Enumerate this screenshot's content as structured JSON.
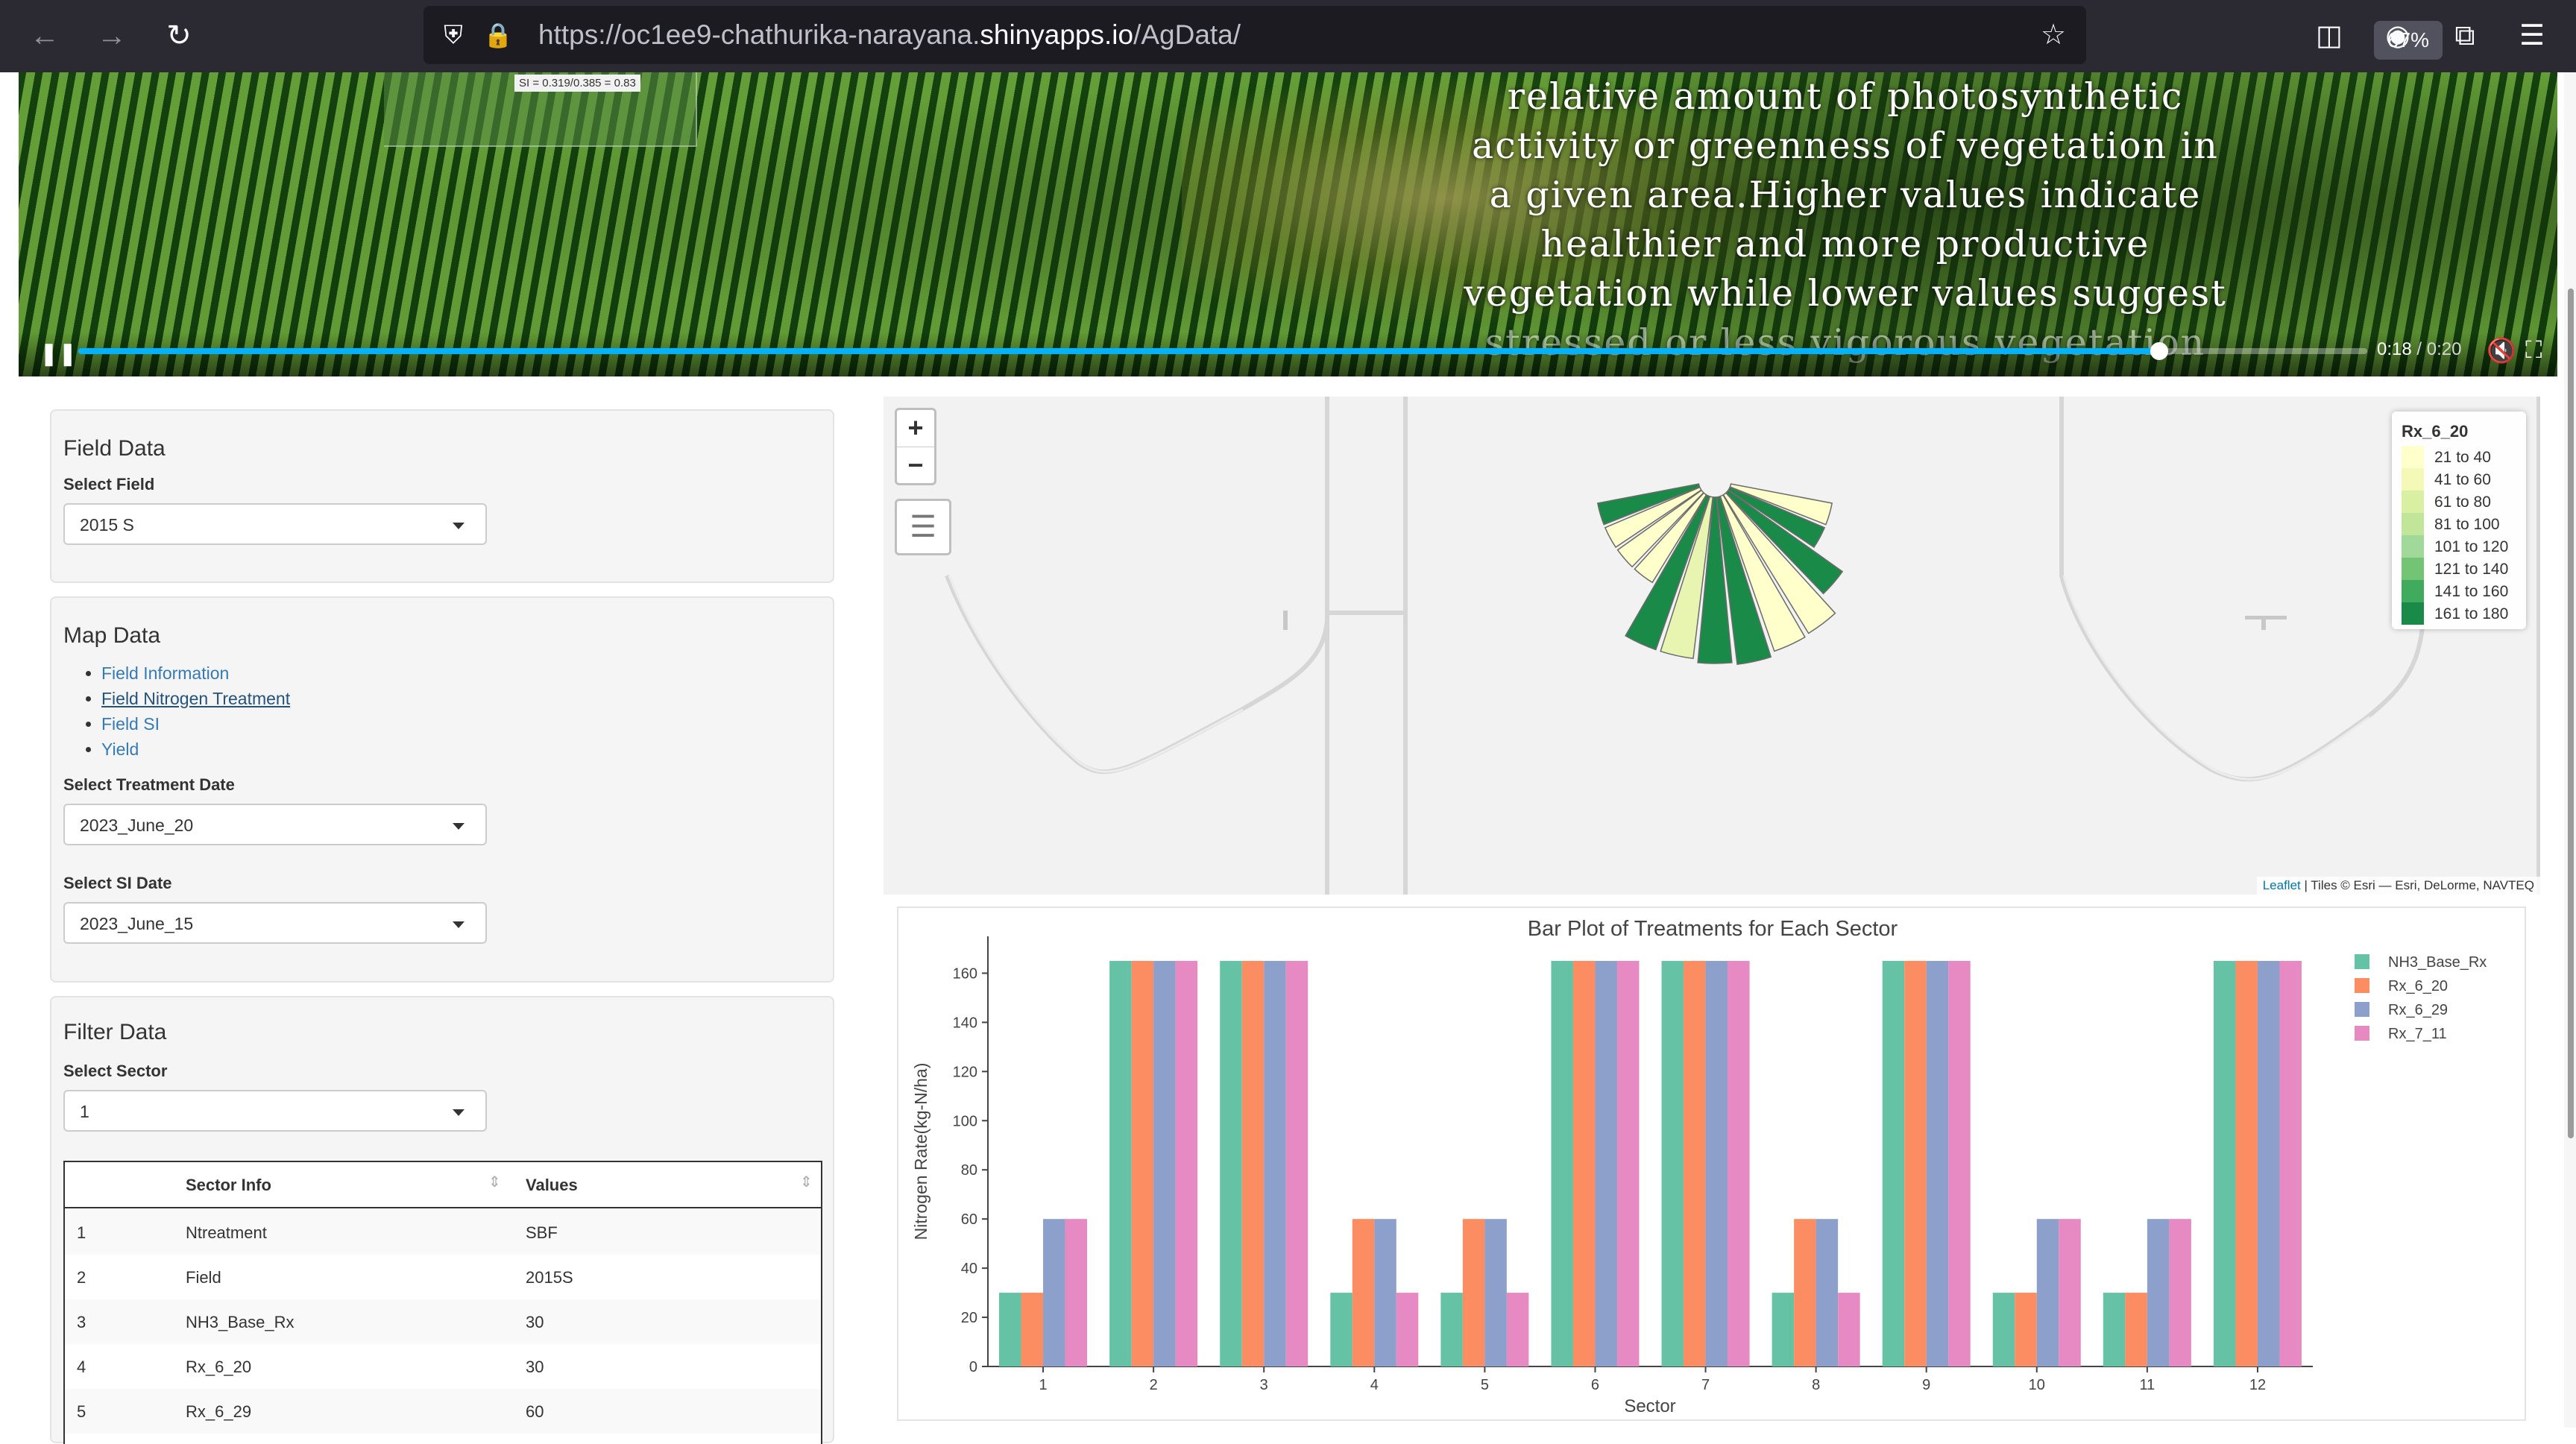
{
  "browser": {
    "url_prefix": "https://oc1ee9-chathurika-narayana.",
    "url_domain": "shinyapps.io",
    "url_path": "/AgData/",
    "zoom": "67%"
  },
  "video": {
    "inset_label": "SI = 0.319/0.385 = 0.83",
    "caption_lines": [
      "relative amount of photosynthetic",
      "activity or greenness of vegetation in",
      "a given area.Higher values indicate",
      "healthier and more productive",
      "vegetation while lower values suggest",
      "stressed or less vigorous vegetation"
    ],
    "current_time": "0:18",
    "separator": " / ",
    "duration": "0:20",
    "progress_fraction": 0.909
  },
  "field_data": {
    "title": "Field Data",
    "select_label": "Select Field",
    "selected": "2015 S"
  },
  "map_data": {
    "title": "Map Data",
    "links": [
      "Field Information",
      "Field Nitrogen Treatment",
      "Field SI",
      "Yield"
    ],
    "treatment_label": "Select Treatment Date",
    "treatment_selected": "2023_June_20",
    "si_label": "Select SI Date",
    "si_selected": "2023_June_15"
  },
  "filter_data": {
    "title": "Filter Data",
    "sector_label": "Select Sector",
    "sector_selected": "1",
    "table": {
      "headers": [
        "Sector Info",
        "Values"
      ],
      "rows": [
        [
          "1",
          "Ntreatment",
          "SBF"
        ],
        [
          "2",
          "Field",
          "2015S"
        ],
        [
          "3",
          "NH3_Base_Rx",
          "30"
        ],
        [
          "4",
          "Rx_6_20",
          "30"
        ],
        [
          "5",
          "Rx_6_29",
          "60"
        ]
      ]
    }
  },
  "map": {
    "zoom_in": "+",
    "zoom_out": "−",
    "layers_icon": "layers-icon",
    "legend_title": "Rx_6_20",
    "legend": [
      {
        "label": "21 to 40",
        "color": "#ffffcc"
      },
      {
        "label": "41 to 60",
        "color": "#f4f9b7"
      },
      {
        "label": "61 to 80",
        "color": "#d9f0a3"
      },
      {
        "label": "81 to 100",
        "color": "#c2e699"
      },
      {
        "label": "101 to 120",
        "color": "#a1d99b"
      },
      {
        "label": "121 to 140",
        "color": "#74c476"
      },
      {
        "label": "141 to 160",
        "color": "#41ab5d"
      },
      {
        "label": "161 to 180",
        "color": "#1a8a49"
      }
    ],
    "sector_colors": [
      "#1a8a49",
      "#ffffcc",
      "#ffffcc",
      "#ffffcc",
      "#1a8a49",
      "#e8f5b0",
      "#1a8a49",
      "#1a8a49",
      "#ffffcc",
      "#ffffcc",
      "#1a8a49",
      "#1a8a49",
      "#ffffcc"
    ],
    "attribution_link": "Leaflet",
    "attribution_text": " | Tiles © Esri — Esri, DeLorme, NAVTEQ"
  },
  "chart_data": {
    "type": "bar",
    "title": "Bar Plot of Treatments for Each Sector",
    "xlabel": "Sector",
    "ylabel": "Nitrogen Rate(kg-N/ha)",
    "ylim": [
      0,
      175
    ],
    "yticks": [
      0,
      20,
      40,
      60,
      80,
      100,
      120,
      140,
      160
    ],
    "legend_position": "top-right",
    "grid": false,
    "categories": [
      "1",
      "2",
      "3",
      "4",
      "5",
      "6",
      "7",
      "8",
      "9",
      "10",
      "11",
      "12"
    ],
    "series": [
      {
        "name": "NH3_Base_Rx",
        "color": "#66c2a5",
        "values": [
          30,
          165,
          165,
          30,
          30,
          165,
          165,
          30,
          165,
          30,
          30,
          165
        ]
      },
      {
        "name": "Rx_6_20",
        "color": "#fc8d62",
        "values": [
          30,
          165,
          165,
          60,
          60,
          165,
          165,
          60,
          165,
          30,
          30,
          165
        ]
      },
      {
        "name": "Rx_6_29",
        "color": "#8da0cb",
        "values": [
          60,
          165,
          165,
          60,
          60,
          165,
          165,
          60,
          165,
          60,
          60,
          165
        ]
      },
      {
        "name": "Rx_7_11",
        "color": "#e78ac3",
        "values": [
          60,
          165,
          165,
          30,
          30,
          165,
          165,
          30,
          165,
          60,
          60,
          165
        ]
      }
    ]
  }
}
